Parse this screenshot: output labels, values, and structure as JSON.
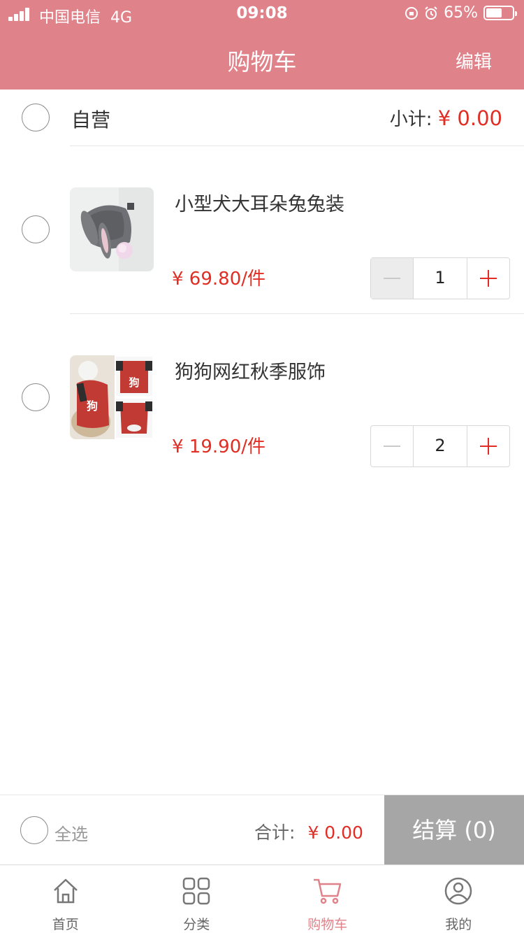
{
  "status_bar": {
    "carrier": "中国电信",
    "network": "4G",
    "time": "09:08",
    "battery": "65%"
  },
  "header": {
    "title": "购物车",
    "edit_label": "编辑"
  },
  "store": {
    "name": "自营",
    "subtotal_label": "小计:",
    "subtotal_value": "¥ 0.00"
  },
  "items": [
    {
      "name": "小型犬大耳朵兔兔装",
      "price": "¥ 69.80/件",
      "quantity": "1",
      "image_icon": "rabbit-ear-dog-costume-photo",
      "minus_disabled": true
    },
    {
      "name": "狗狗网红秋季服饰",
      "price": "¥ 19.90/件",
      "quantity": "2",
      "image_icon": "red-dog-shirt-photo",
      "minus_disabled": false
    }
  ],
  "summary": {
    "select_all_label": "全选",
    "total_label": "合计:",
    "total_value": "¥ 0.00",
    "checkout_label": "结算 (0)"
  },
  "tabbar": [
    {
      "label": "首页",
      "icon": "home-icon",
      "active": false
    },
    {
      "label": "分类",
      "icon": "category-icon",
      "active": false
    },
    {
      "label": "购物车",
      "icon": "cart-icon",
      "active": true
    },
    {
      "label": "我的",
      "icon": "profile-icon",
      "active": false
    }
  ],
  "colors": {
    "brand": "#e0828a",
    "price": "#e02e24",
    "checkout_disabled": "#a6a6a6"
  }
}
